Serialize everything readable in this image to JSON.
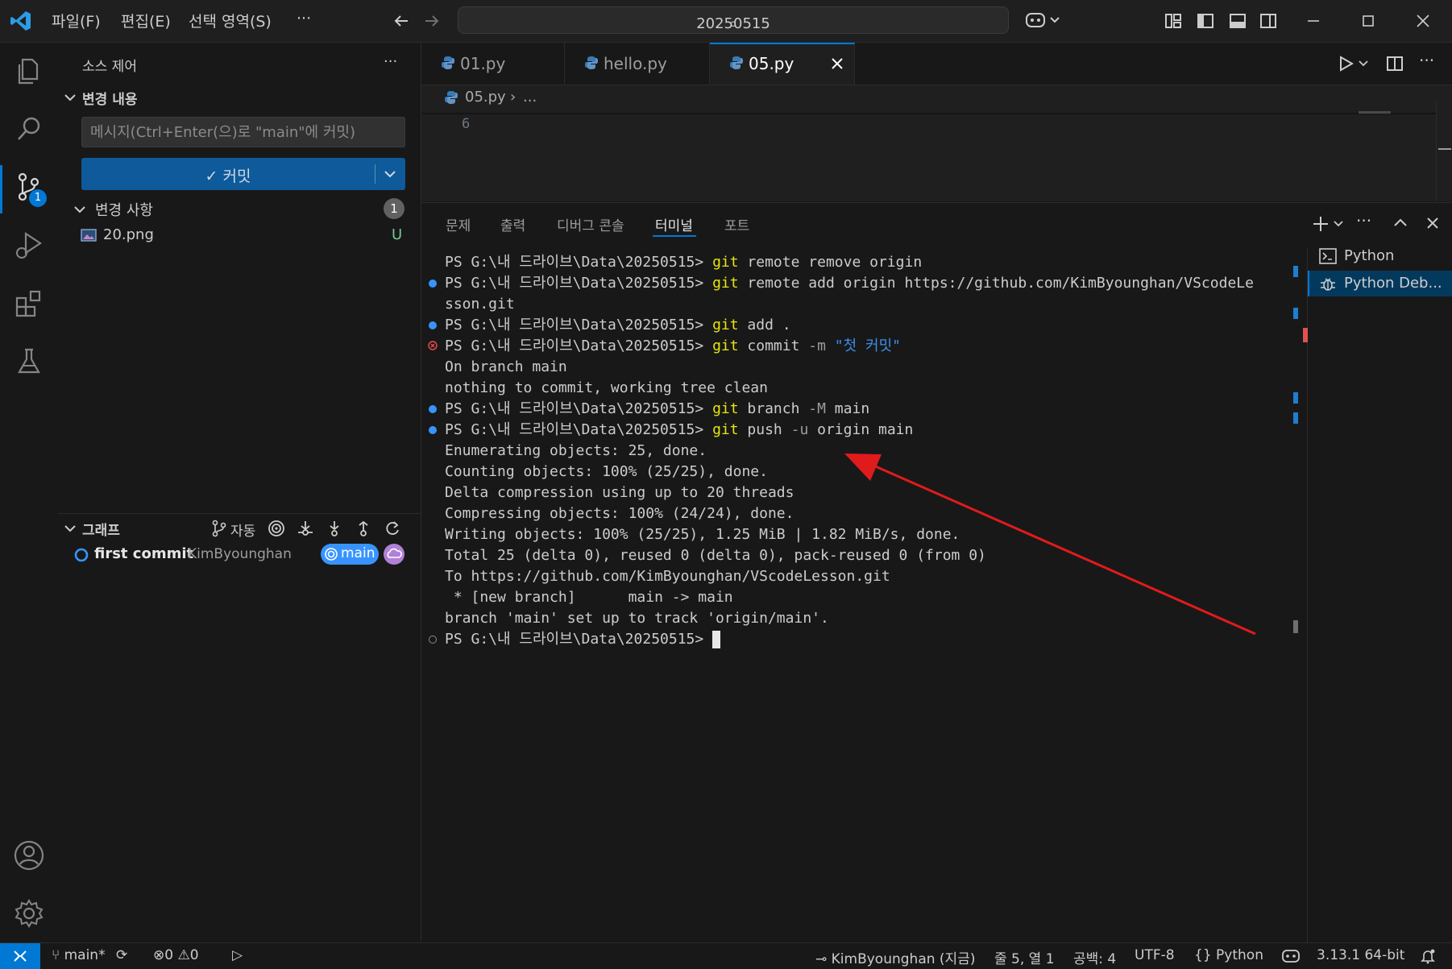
{
  "titlebar": {
    "menus": [
      "파일(F)",
      "편집(E)",
      "선택 영역(S)",
      "···"
    ],
    "search": "20250515"
  },
  "activity": {
    "items": [
      "explorer-icon",
      "search-icon",
      "source-control-icon",
      "run-debug-icon",
      "extensions-icon",
      "testing-icon"
    ],
    "scm_badge": "1",
    "bottom": [
      "accounts-icon",
      "settings-gear-icon"
    ]
  },
  "sidebar": {
    "title": "소스 제어",
    "more": "···",
    "changes_section": "변경 내용",
    "commit_placeholder": "메시지(Ctrl+Enter(으)로 \"main\"에 커밋)",
    "commit_button": "✓ 커밋",
    "changes_group": "변경 사항",
    "changes_count": "1",
    "files": [
      {
        "name": "20.png",
        "status": "U"
      }
    ],
    "graph_section": "그래프",
    "graph_auto": "자동",
    "graph_commit": {
      "message": "first commit",
      "author": "KimByounghan",
      "branch": "main"
    }
  },
  "tabs": [
    {
      "label": "01.py",
      "active": false
    },
    {
      "label": "hello.py",
      "active": false
    },
    {
      "label": "05.py",
      "active": true
    }
  ],
  "breadcrumb": {
    "file": "05.py",
    "rest": "..."
  },
  "editor": {
    "line_number": "6"
  },
  "panel": {
    "tabs": [
      "문제",
      "출력",
      "디버그 콘솔",
      "터미널",
      "포트"
    ],
    "active_tab": "터미널",
    "terminals": [
      "Python",
      "Python Deb..."
    ]
  },
  "terminal": {
    "prompt": "PS G:\\내 드라이브\\Data\\20250515> ",
    "lines": {
      "l1_cmd": "git",
      "l1_args": " remote remove origin",
      "l2_cmd": "git",
      "l2_args": " remote add origin https://github.com/KimByounghan/VScodeLe",
      "l3": "sson.git",
      "l4_cmd": "git",
      "l4_args": " add .",
      "l5_cmd": "git",
      "l5_args1": " commit ",
      "l5_flag": "-m",
      "l5_str": " \"첫 커밋\"",
      "l6": "On branch main",
      "l7": "nothing to commit, working tree clean",
      "l8_cmd": "git",
      "l8_args1": " branch ",
      "l8_flag": "-M",
      "l8_args2": " main",
      "l9_cmd": "git",
      "l9_args1": " push ",
      "l9_flag": "-u",
      "l9_args2": " origin main",
      "l10": "Enumerating objects: 25, done.",
      "l11": "Counting objects: 100% (25/25), done.",
      "l12": "Delta compression using up to 20 threads",
      "l13": "Compressing objects: 100% (24/24), done.",
      "l14": "Writing objects: 100% (25/25), 1.25 MiB | 1.82 MiB/s, done.",
      "l15": "Total 25 (delta 0), reused 0 (delta 0), pack-reused 0 (from 0)",
      "l16": "To https://github.com/KimByounghan/VScodeLesson.git",
      "l17": " * [new branch]      main -> main",
      "l18": "branch 'main' set up to track 'origin/main'."
    }
  },
  "statusbar": {
    "branch": "main*",
    "errors": "0",
    "warnings": "0",
    "author": "KimByounghan (지금)",
    "position": "줄 5, 열 1",
    "spaces": "공백: 4",
    "encoding": "UTF-8",
    "language": "Python",
    "interpreter": "3.13.1 64-bit"
  },
  "colors": {
    "accent": "#0078d4",
    "commit_button": "#0e5a9a",
    "arrow": "#e01b1b",
    "branch_badge": "#3794ff",
    "remote_badge": "#b180d7"
  }
}
